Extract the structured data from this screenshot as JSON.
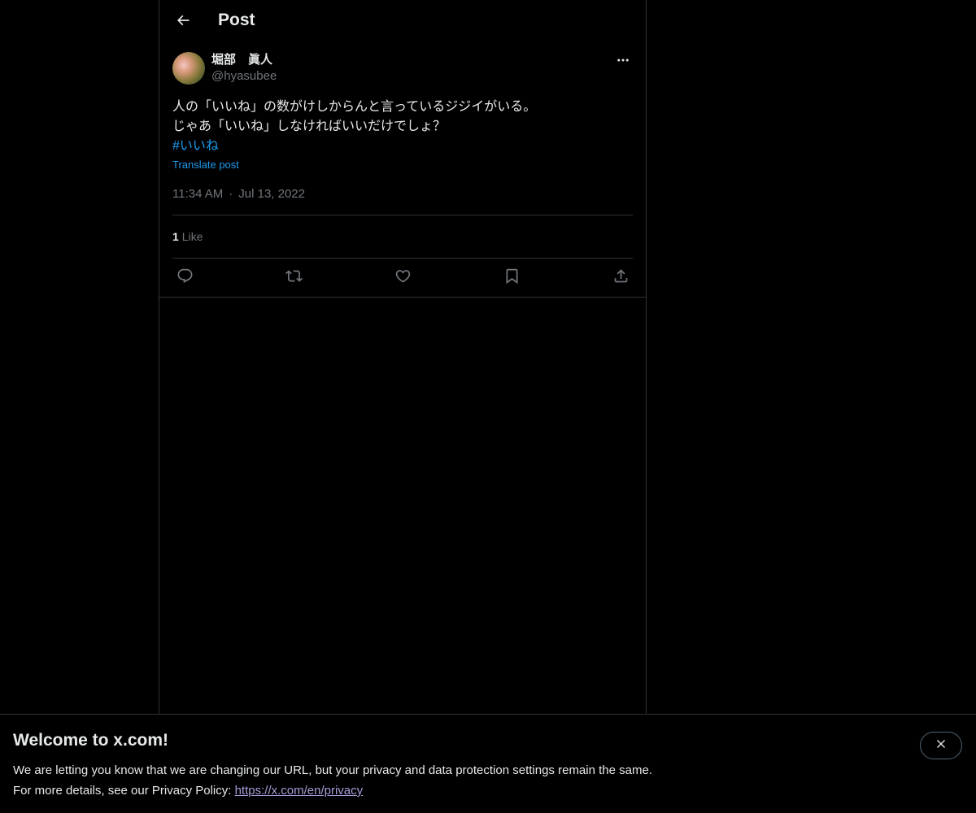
{
  "header": {
    "title": "Post",
    "back_icon": "arrow-left-icon"
  },
  "post": {
    "author": {
      "display_name": "堀部　眞人",
      "handle": "@hyasubee"
    },
    "text_lines": [
      "人の「いいね」の数がけしからんと言っているジジイがいる。",
      "じゃあ「いいね」しなければいいだけでしょ？"
    ],
    "hashtag": "#いいね",
    "translate_label": "Translate post",
    "time": "11:34 AM",
    "separator": "·",
    "date": "Jul 13, 2022",
    "likes_count": "1",
    "likes_label": "Like",
    "actions": [
      "reply-icon",
      "repost-icon",
      "like-icon",
      "bookmark-icon",
      "share-icon"
    ]
  },
  "banner": {
    "title": "Welcome to x.com!",
    "line1": "We are letting you know that we are changing our URL, but your privacy and data protection settings remain the same.",
    "line2_prefix": "For more details, see our Privacy Policy: ",
    "link": "https://x.com/en/privacy"
  },
  "colors": {
    "background": "#000000",
    "text": "#e7e9ea",
    "secondary_text": "#71767b",
    "accent": "#1d9bf0",
    "border": "#2f3336",
    "link_visited": "#a89dd9"
  }
}
